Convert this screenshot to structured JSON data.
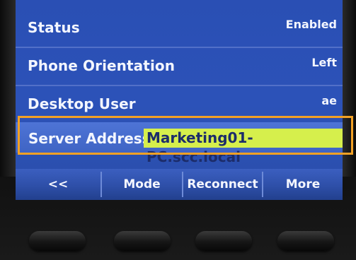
{
  "settings": {
    "rows": [
      {
        "label": "Status",
        "value": "Enabled"
      },
      {
        "label": "Phone Orientation",
        "value": "Left"
      },
      {
        "label": "Desktop User",
        "value": "ae"
      }
    ],
    "server": {
      "label": "Server Address",
      "value": "Marketing01-PC.scc.local"
    }
  },
  "softkeys": {
    "back": "<<",
    "mode": "Mode",
    "reconnect": "Reconnect",
    "more": "More"
  },
  "colors": {
    "screen_bg": "#2c52b8",
    "selected_row_bg": "#4e74d6",
    "value_highlight": "#d6ef4c",
    "annotation_box": "#f2a125"
  }
}
